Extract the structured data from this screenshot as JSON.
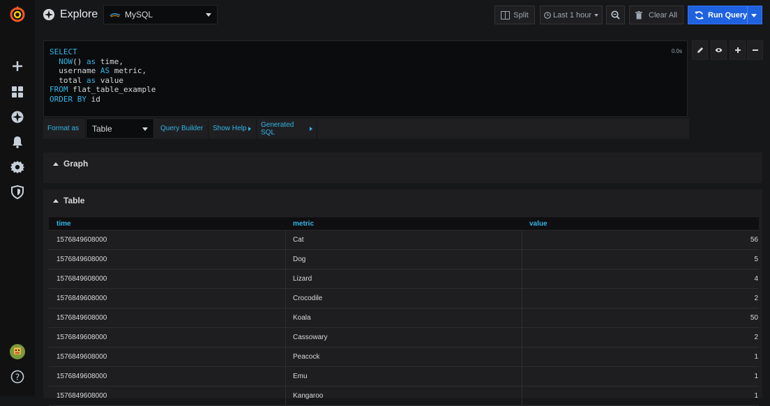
{
  "colors": {
    "accent": "#33b5e5",
    "run_button": "#1f62e0",
    "grafana_orange": "#f05a28"
  },
  "header": {
    "title": "Explore",
    "datasource": "MySQL",
    "split_label": "Split",
    "time_range": "Last 1 hour",
    "clear_all_label": "Clear All",
    "run_query_label": "Run Query"
  },
  "editor": {
    "timing": "0.0s",
    "query_lines": [
      "SELECT",
      "  NOW() as time,",
      "  username AS metric,",
      "  total as value",
      "FROM flat_table_example",
      "ORDER BY id"
    ]
  },
  "query_toolbar": {
    "format_as_label": "Format as",
    "format_value": "Table",
    "query_builder_label": "Query Builder",
    "show_help_label": "Show Help",
    "generated_sql_label": "Generated SQL"
  },
  "panels": {
    "graph_title": "Graph",
    "table_title": "Table"
  },
  "table": {
    "columns": [
      "time",
      "metric",
      "value"
    ],
    "rows": [
      [
        "1576849608000",
        "Cat",
        "56"
      ],
      [
        "1576849608000",
        "Dog",
        "5"
      ],
      [
        "1576849608000",
        "Lizard",
        "4"
      ],
      [
        "1576849608000",
        "Crocodile",
        "2"
      ],
      [
        "1576849608000",
        "Koala",
        "50"
      ],
      [
        "1576849608000",
        "Cassowary",
        "2"
      ],
      [
        "1576849608000",
        "Peacock",
        "1"
      ],
      [
        "1576849608000",
        "Emu",
        "1"
      ],
      [
        "1576849608000",
        "Kangaroo",
        "1"
      ]
    ]
  },
  "icons": {
    "sidebar": [
      "grafana-logo-icon",
      "plus-icon",
      "dashboards-icon",
      "explore-icon",
      "bell-icon",
      "gear-icon",
      "shield-icon",
      "user-avatar-icon",
      "help-icon"
    ]
  }
}
